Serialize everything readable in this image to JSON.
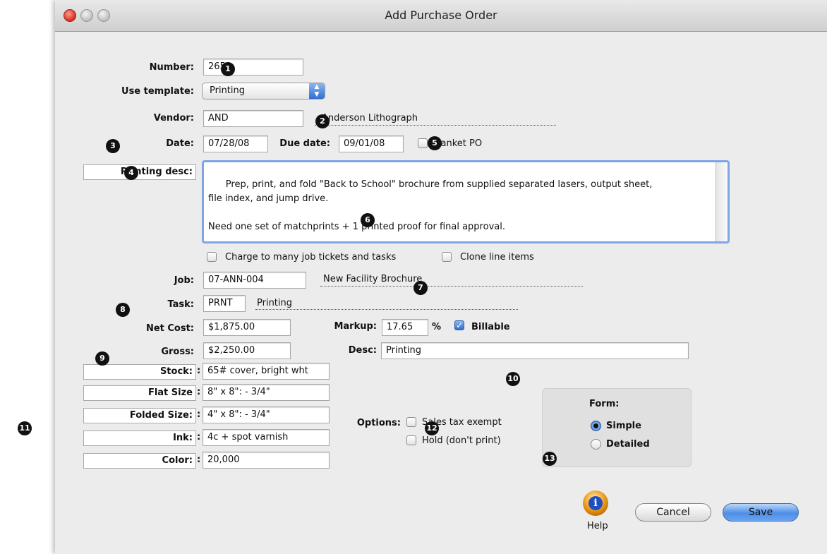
{
  "window": {
    "title": "Add Purchase Order"
  },
  "form": {
    "number_label": "Number:",
    "number_value": "2651",
    "template_label": "Use template:",
    "template_value": "Printing",
    "vendor_label": "Vendor:",
    "vendor_code": "AND",
    "vendor_name": "Anderson Lithograph",
    "date_label": "Date:",
    "date_value": "07/28/08",
    "due_label": "Due date:",
    "due_value": "09/01/08",
    "blanket_label": "Blanket PO",
    "desc_label": "Printing desc:",
    "desc_text": "Prep, print, and fold \"Back to School\" brochure from supplied separated lasers, output sheet,\nfile index, and jump drive.\n\nNeed one set of matchprints + 1 printed proof for final approval.",
    "charge_label": "Charge to many job tickets and tasks",
    "clone_label": "Clone line items",
    "job_label": "Job:",
    "job_value": "07-ANN-004",
    "job_name": "New Facility Brochure",
    "task_label": "Task:",
    "task_value": "PRNT",
    "task_name": "Printing",
    "netcost_label": "Net Cost:",
    "netcost_value": "$1,875.00",
    "markup_label": "Markup:",
    "markup_value": "17.65",
    "markup_unit": "%",
    "billable_label": "Billable",
    "gross_label": "Gross:",
    "gross_value": "$2,250.00",
    "linedesc_label": "Desc:",
    "linedesc_value": "Printing",
    "specs": [
      {
        "label": "Stock:",
        "value": "65# cover, bright wht"
      },
      {
        "label": "Flat Size",
        "value": "8\" x 8\": - 3/4\""
      },
      {
        "label": "Folded Size:",
        "value": "4\" x 8\": - 3/4\""
      },
      {
        "label": "Ink:",
        "value": "4c + spot varnish"
      },
      {
        "label": "Color:",
        "value": "20,000"
      }
    ],
    "options_label": "Options:",
    "tax_exempt_label": "Sales tax exempt",
    "hold_label": "Hold (don't print)",
    "form_label": "Form:",
    "form_simple": "Simple",
    "form_detailed": "Detailed"
  },
  "buttons": {
    "help": "Help",
    "cancel": "Cancel",
    "save": "Save"
  },
  "callouts": [
    "1",
    "2",
    "3",
    "4",
    "5",
    "6",
    "7",
    "8",
    "9",
    "10",
    "11",
    "12",
    "13"
  ],
  "colors": {
    "accent": "#2f6fd1",
    "focus_ring": "#7fa6e3"
  }
}
